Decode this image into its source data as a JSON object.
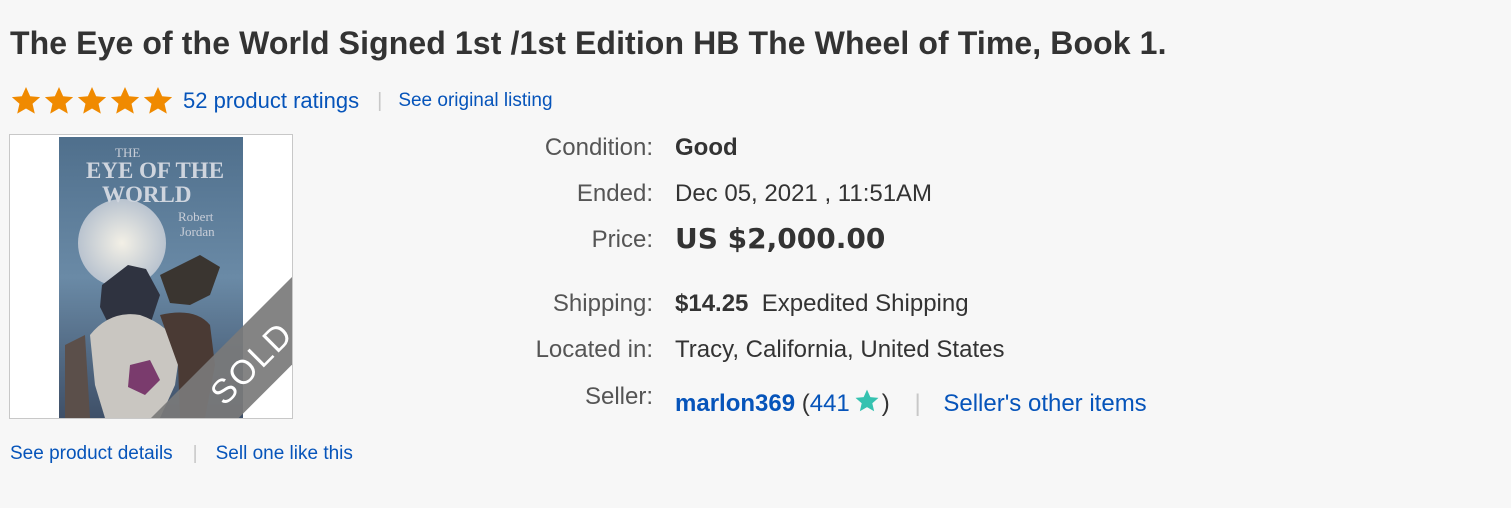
{
  "listing": {
    "title": "The Eye of the World Signed 1st /1st Edition HB The Wheel of Time, Book 1.",
    "rating": {
      "stars": 5,
      "star_color": "#f08a00",
      "count_text": "52 product ratings",
      "see_original_label": "See original listing"
    },
    "image": {
      "badge_text": "SOLD",
      "cover_lines": [
        "THE",
        "EYE OF THE",
        "WORLD",
        "Robert",
        "Jordan"
      ]
    },
    "links": {
      "see_product_details": "See product details",
      "sell_one_like_this": "Sell one like this"
    }
  },
  "details": {
    "condition": {
      "label": "Condition:",
      "value": "Good"
    },
    "ended": {
      "label": "Ended:",
      "value": "Dec 05, 2021 , 11:51AM"
    },
    "price": {
      "label": "Price:",
      "value": "US $2,000.00"
    },
    "shipping": {
      "label": "Shipping:",
      "cost": "$14.25",
      "method": "Expedited Shipping"
    },
    "location": {
      "label": "Located in:",
      "value": "Tracy, California, United States"
    },
    "seller": {
      "label": "Seller:",
      "name": "marlon369",
      "open_paren": "(",
      "feedback_score": "441",
      "close_paren": ")",
      "star_color": "#35c2b0",
      "other_items_label": "Seller's other items"
    }
  },
  "colors": {
    "link": "#0654ba",
    "text": "#333333",
    "background": "#f7f7f7"
  }
}
